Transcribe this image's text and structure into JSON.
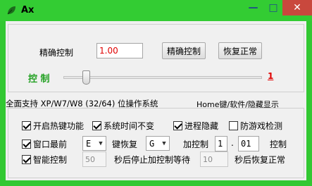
{
  "window": {
    "title": "Ax",
    "minimize_glyph": "—",
    "maximize_glyph": "□",
    "close_glyph": "✕"
  },
  "precise": {
    "label": "精确控制",
    "value": "1.00",
    "apply_button": "精确控制",
    "reset_button": "恢复正常"
  },
  "slider": {
    "label": "控 制",
    "value_text": "1",
    "level": 0.1
  },
  "colors": {
    "title_bar": "#33cc33",
    "slider_label": "#22a022",
    "value_red": "#e00000",
    "close_button": "#c9483d"
  },
  "info": {
    "os_support": "全面支持 XP/W7/W8 (32/64) 位操作系统",
    "hotkey_hint": "Home键/软件/隐藏显示"
  },
  "options": {
    "hotkey": {
      "label": "开启热键功能",
      "checked": true
    },
    "systime": {
      "label": "系统时间不变",
      "checked": true
    },
    "hide_process": {
      "label": "进程隐藏",
      "checked": true
    },
    "anti_detect": {
      "label": "防游戏检测",
      "checked": false
    },
    "topmost": {
      "label": "窗口最前",
      "checked": true
    },
    "smart": {
      "label": "智能控制",
      "checked": true
    }
  },
  "keys": {
    "key1": "E",
    "restore_key_label": "键恢复",
    "key2": "G",
    "add_label": "加控制",
    "add_int": "1",
    "dot": ".",
    "add_frac": "01",
    "control_label": "控制"
  },
  "smart_row": {
    "seconds1": "50",
    "text1": "秒后停止加控制等待",
    "seconds2": "10",
    "text2": "秒后恢复正常"
  },
  "icons": {
    "app": "leaf-icon",
    "check": "checkmark-icon",
    "dropdown": "chevron-down-icon"
  }
}
